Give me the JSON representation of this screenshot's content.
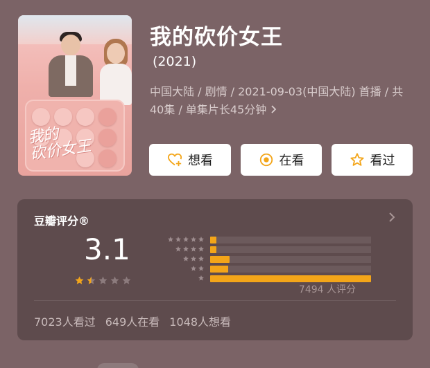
{
  "movie": {
    "title": "我的砍价女王",
    "year": "(2021)",
    "meta": "中国大陆 / 剧情 / 2021-09-03(中国大陆) 首播 / 共40集 / 单集片长45分钟",
    "poster_logo": "我的砍价女王"
  },
  "actions": {
    "want_label": "想看",
    "doing_label": "在看",
    "done_label": "看过",
    "icons": [
      "heart-plus-icon",
      "target-circle-icon",
      "star-outline-icon"
    ],
    "accent": "#f3a519"
  },
  "rating": {
    "section_title": "豆瓣评分®",
    "score": "3.1",
    "stars_filled": 1.5,
    "stars_total": 5,
    "distribution_fraction_of_max": [
      0.04,
      0.04,
      0.12,
      0.11,
      1.0
    ],
    "distribution_star_counts": [
      5,
      4,
      3,
      2,
      1
    ],
    "total_ratings": "7494 人评分"
  },
  "stats": {
    "watched": "7023人看过",
    "watching": "649人在看",
    "want": "1048人想看"
  }
}
